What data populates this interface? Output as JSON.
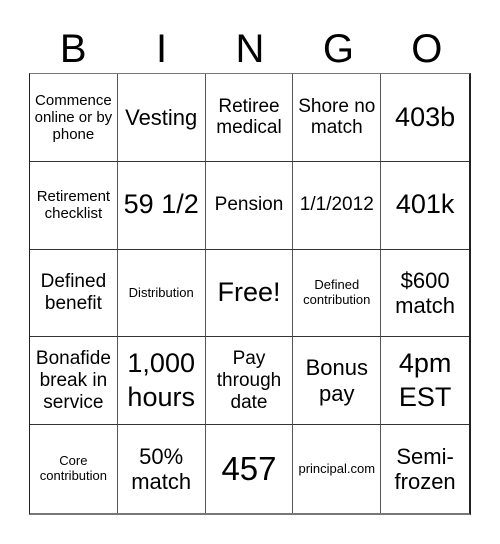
{
  "header": {
    "letters": [
      "B",
      "I",
      "N",
      "G",
      "O"
    ]
  },
  "card": {
    "rows": [
      [
        "Commence online or by phone",
        "Vesting",
        "Retiree medical",
        "Shore no match",
        "403b"
      ],
      [
        "Retirement checklist",
        "59 1/2",
        "Pension",
        "1/1/2012",
        "401k"
      ],
      [
        "Defined benefit",
        "Distribution",
        "Free!",
        "Defined contribution",
        "$600 match"
      ],
      [
        "Bonafide break in service",
        "1,000 hours",
        "Pay through date",
        "Bonus pay",
        "4pm EST"
      ],
      [
        "Core contribution",
        "50% match",
        "457",
        "principal.com",
        "Semi-frozen"
      ]
    ],
    "free_space": {
      "row": 2,
      "col": 2
    }
  },
  "colors": {
    "grid_line": "#333333",
    "text": "#000000",
    "background": "#ffffff"
  }
}
